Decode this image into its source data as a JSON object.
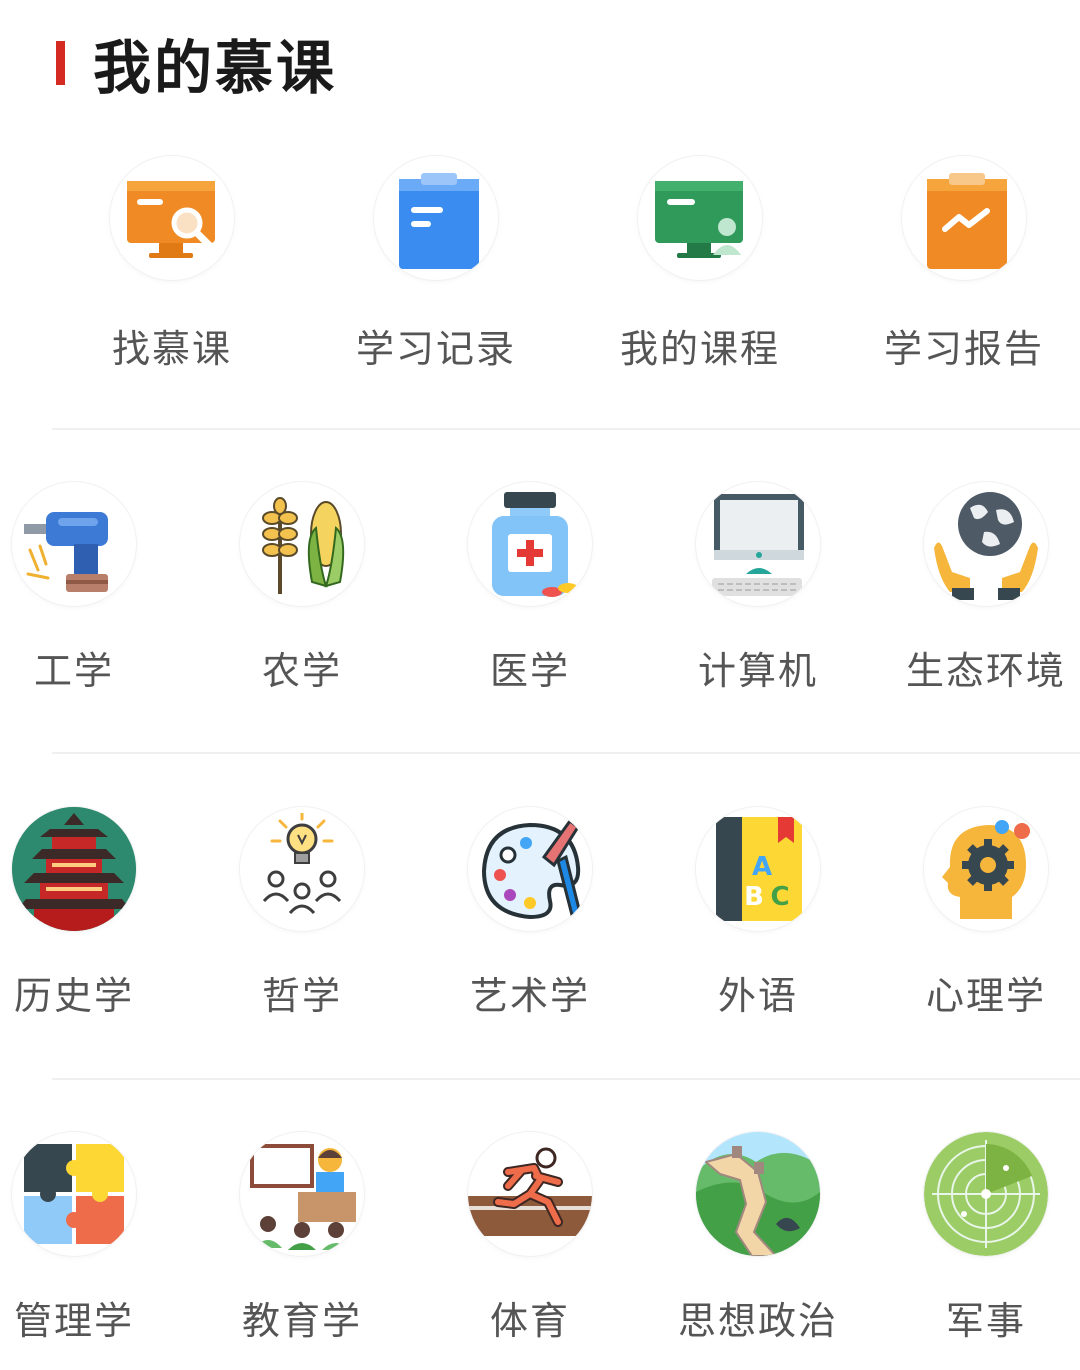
{
  "header": {
    "title": "我的慕课",
    "accent_color": "#d42a22"
  },
  "quick_actions": [
    {
      "label": "找慕课",
      "icon": "monitor-search-icon"
    },
    {
      "label": "学习记录",
      "icon": "clipboard-record-icon"
    },
    {
      "label": "我的课程",
      "icon": "monitor-user-icon"
    },
    {
      "label": "学习报告",
      "icon": "clipboard-chart-icon"
    }
  ],
  "categories": [
    {
      "label": "工学",
      "icon": "drill-icon"
    },
    {
      "label": "农学",
      "icon": "wheat-corn-icon"
    },
    {
      "label": "医学",
      "icon": "medicine-bottle-icon"
    },
    {
      "label": "计算机",
      "icon": "computer-icon"
    },
    {
      "label": "生态环境",
      "icon": "globe-hands-icon"
    },
    {
      "label": "历史学",
      "icon": "pagoda-icon"
    },
    {
      "label": "哲学",
      "icon": "lightbulb-people-icon"
    },
    {
      "label": "艺术学",
      "icon": "palette-icon"
    },
    {
      "label": "外语",
      "icon": "abc-book-icon"
    },
    {
      "label": "心理学",
      "icon": "head-gears-icon"
    },
    {
      "label": "管理学",
      "icon": "puzzle-icon"
    },
    {
      "label": "教育学",
      "icon": "teacher-icon"
    },
    {
      "label": "体育",
      "icon": "runner-icon"
    },
    {
      "label": "思想政治",
      "icon": "great-wall-icon"
    },
    {
      "label": "军事",
      "icon": "radar-icon"
    }
  ]
}
